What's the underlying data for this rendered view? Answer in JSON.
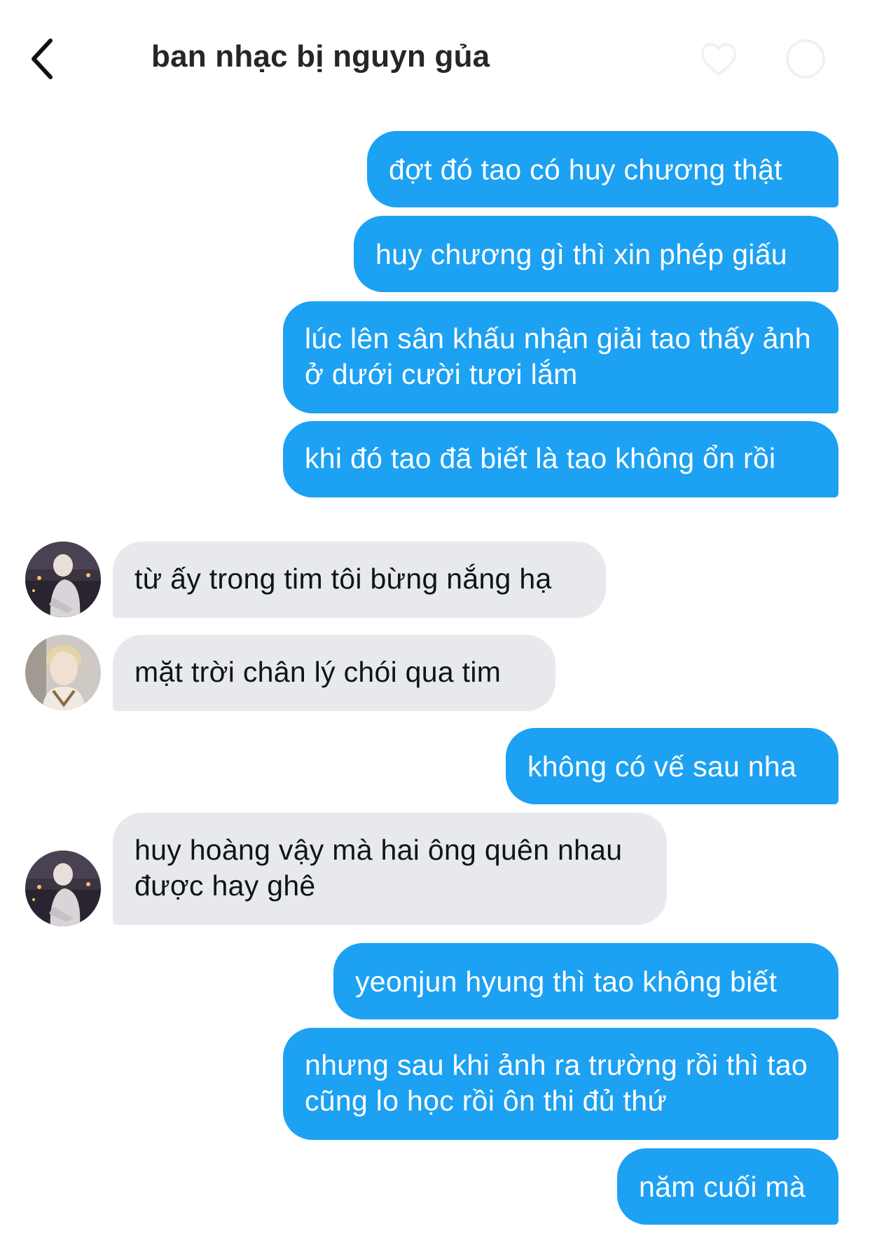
{
  "header": {
    "title": "ban nhạc bị nguyn gủa"
  },
  "colors": {
    "sent_bubble": "#1da1f2",
    "received_bubble": "#e8e9ed",
    "text_dark": "#262626"
  },
  "messages": [
    {
      "direction": "sent",
      "text": "đợt đó tao có huy chương thật"
    },
    {
      "direction": "sent",
      "text": "huy chương gì thì xin phép giấu"
    },
    {
      "direction": "sent",
      "text": "lúc lên sân khấu nhận giải tao thấy ảnh ở dưới cười tươi lắm"
    },
    {
      "direction": "sent",
      "text": "khi đó tao đã biết là tao không ổn rồi"
    },
    {
      "direction": "received",
      "text": "từ ấy trong tim tôi bừng nắng hạ",
      "avatar": "avatar-1"
    },
    {
      "direction": "received",
      "text": "mặt trời chân lý chói qua tim",
      "avatar": "avatar-2"
    },
    {
      "direction": "sent",
      "text": "không có vế sau nha"
    },
    {
      "direction": "received",
      "text": "huy hoàng vậy mà hai ông quên nhau được hay ghê",
      "avatar": "avatar-1"
    },
    {
      "direction": "sent",
      "text": "yeonjun hyung thì tao không biết"
    },
    {
      "direction": "sent",
      "text": "nhưng sau khi ảnh ra trường rồi thì tao cũng lo học rồi ôn thi đủ thứ"
    },
    {
      "direction": "sent",
      "text": "năm cuối mà"
    }
  ]
}
